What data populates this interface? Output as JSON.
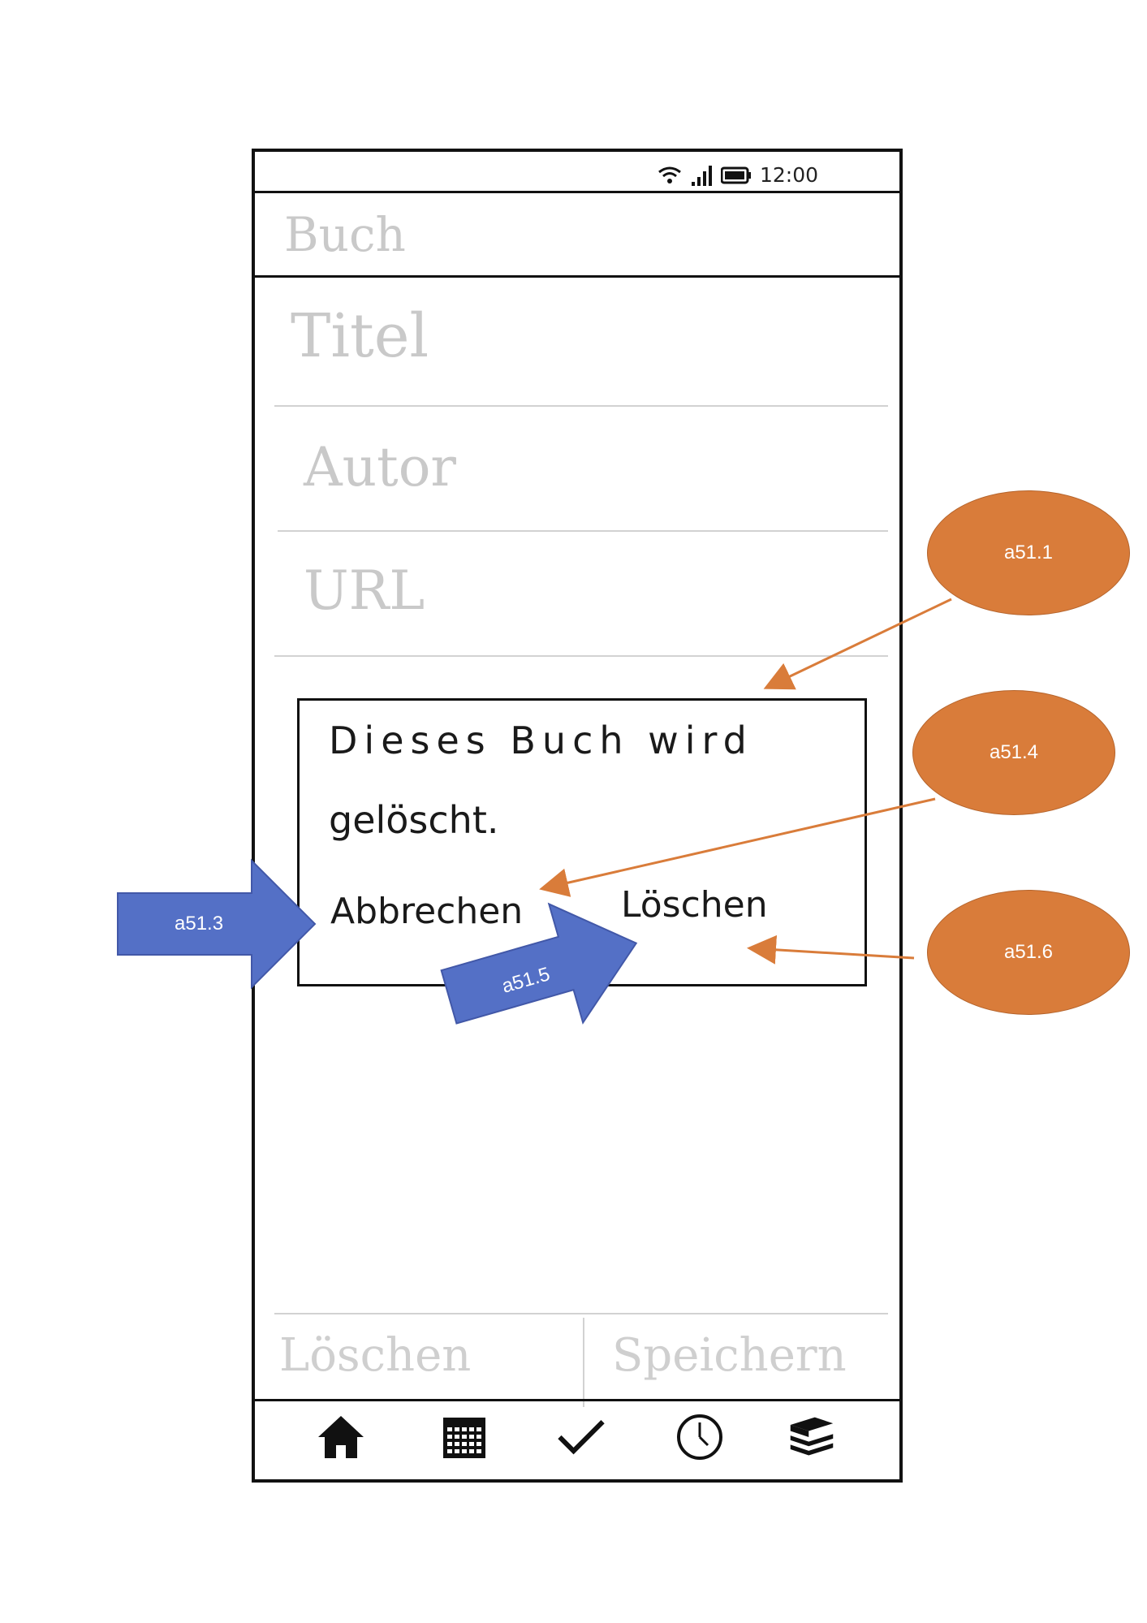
{
  "status_bar": {
    "time": "12:00"
  },
  "app_bar": {
    "title": "Buch"
  },
  "form": {
    "title_placeholder": "Titel",
    "author_placeholder": "Autor",
    "url_placeholder": "URL"
  },
  "dialog": {
    "message_line1": "Dieses Buch wird",
    "message_line2": "gelöscht.",
    "cancel_label": "Abbrechen",
    "delete_label": "Löschen"
  },
  "bottom_actions": {
    "delete_label": "Löschen",
    "save_label": "Speichern"
  },
  "nav": {
    "items": [
      "home-icon",
      "calendar-icon",
      "check-icon",
      "clock-icon",
      "books-icon"
    ]
  },
  "annotations": {
    "oval_1": "a51.1",
    "oval_4": "a51.4",
    "oval_6": "a51.6",
    "arrow_3": "a51.3",
    "arrow_5": "a51.5",
    "oval_color": "#d97c3a",
    "arrow_color": "#5470c6"
  }
}
